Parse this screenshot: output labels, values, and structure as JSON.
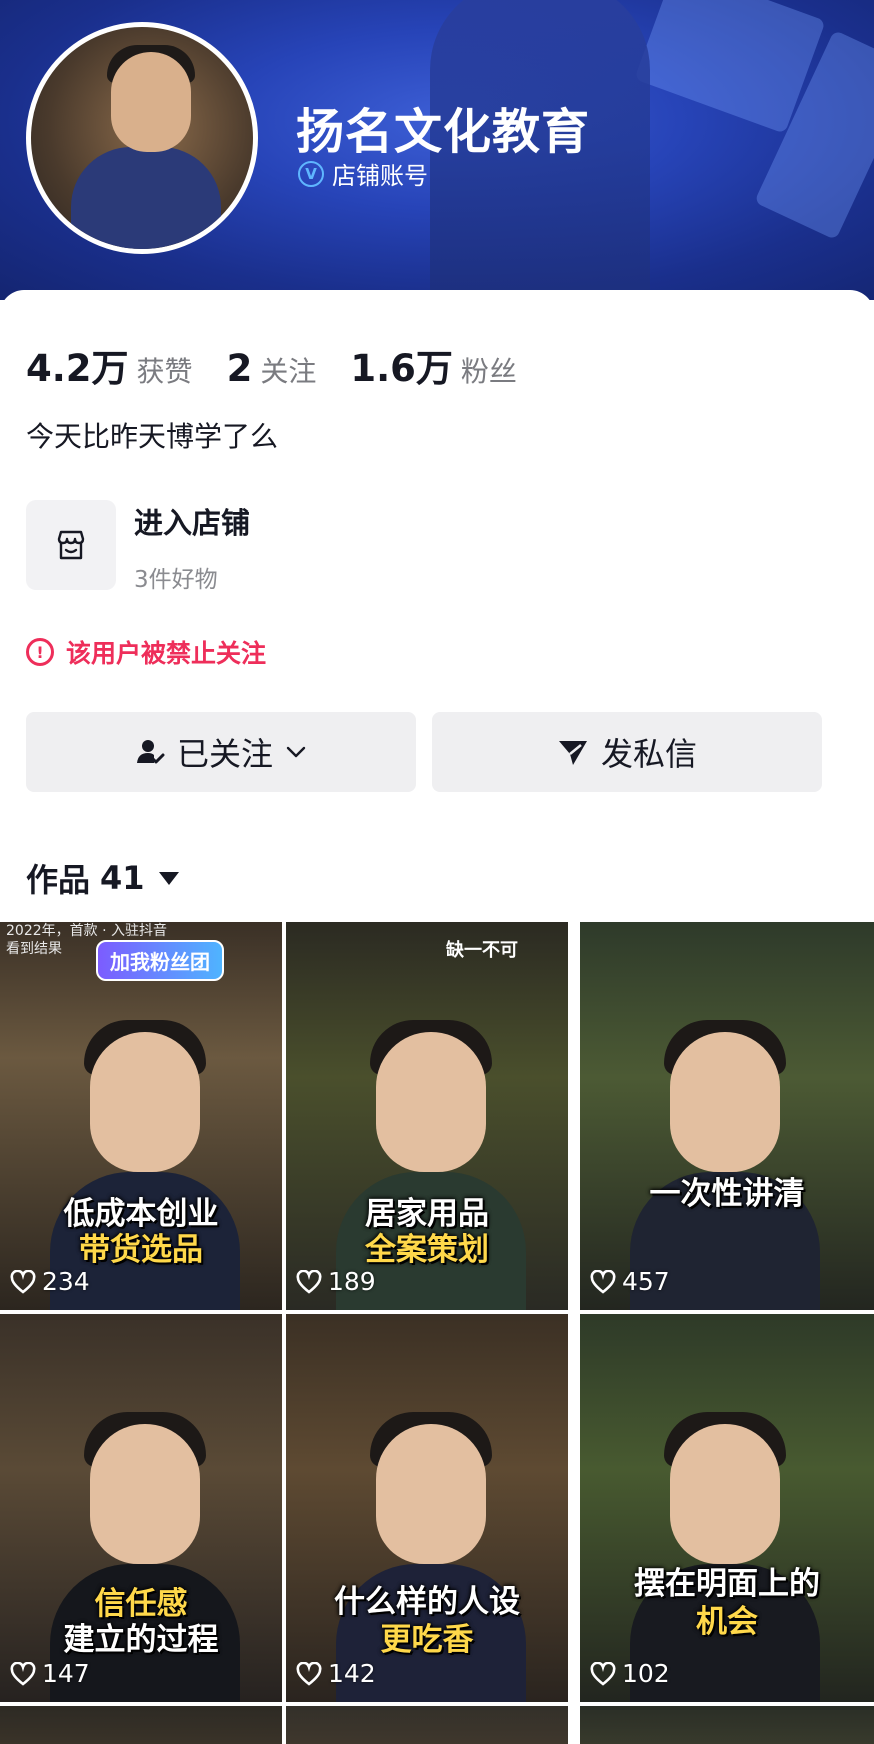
{
  "profile": {
    "name": "扬名文化教育",
    "badge": "店铺账号"
  },
  "stats": [
    {
      "num": "4.2万",
      "label": "获赞"
    },
    {
      "num": "2",
      "label": "关注"
    },
    {
      "num": "1.6万",
      "label": "粉丝"
    }
  ],
  "bio": "今天比昨天博学了么",
  "shop": {
    "title": "进入店铺",
    "subtitle": "3件好物"
  },
  "warning": "该用户被禁止关注",
  "buttons": {
    "follow": "已关注",
    "message": "发私信"
  },
  "works": {
    "label": "作品",
    "count": "41"
  },
  "videos": [
    {
      "line1": "低成本创业",
      "line2": "带货选品",
      "likes": "234",
      "tag": "加我粉丝团",
      "top_text": "2022年，首款 · 入驻抖音\n看到结果"
    },
    {
      "line1": "居家用品",
      "line2": "全案策划",
      "likes": "189",
      "top_text": "缺一不可"
    },
    {
      "line1": "一次性讲清",
      "line2": "",
      "likes": "457",
      "top_text": ""
    },
    {
      "line1": "信任感",
      "line2": "建立的过程",
      "likes": "147",
      "top_text": ""
    },
    {
      "line1": "什么样的人设",
      "line2": "更吃香",
      "likes": "142",
      "top_text": ""
    },
    {
      "line1": "摆在明面上的",
      "line2": "机会",
      "likes": "102",
      "top_text": ""
    }
  ],
  "colors": {
    "banner": "#2744b8",
    "warning": "#ee2e5a",
    "button_bg": "#efeff1",
    "caption_yellow": "#ffd84a"
  }
}
